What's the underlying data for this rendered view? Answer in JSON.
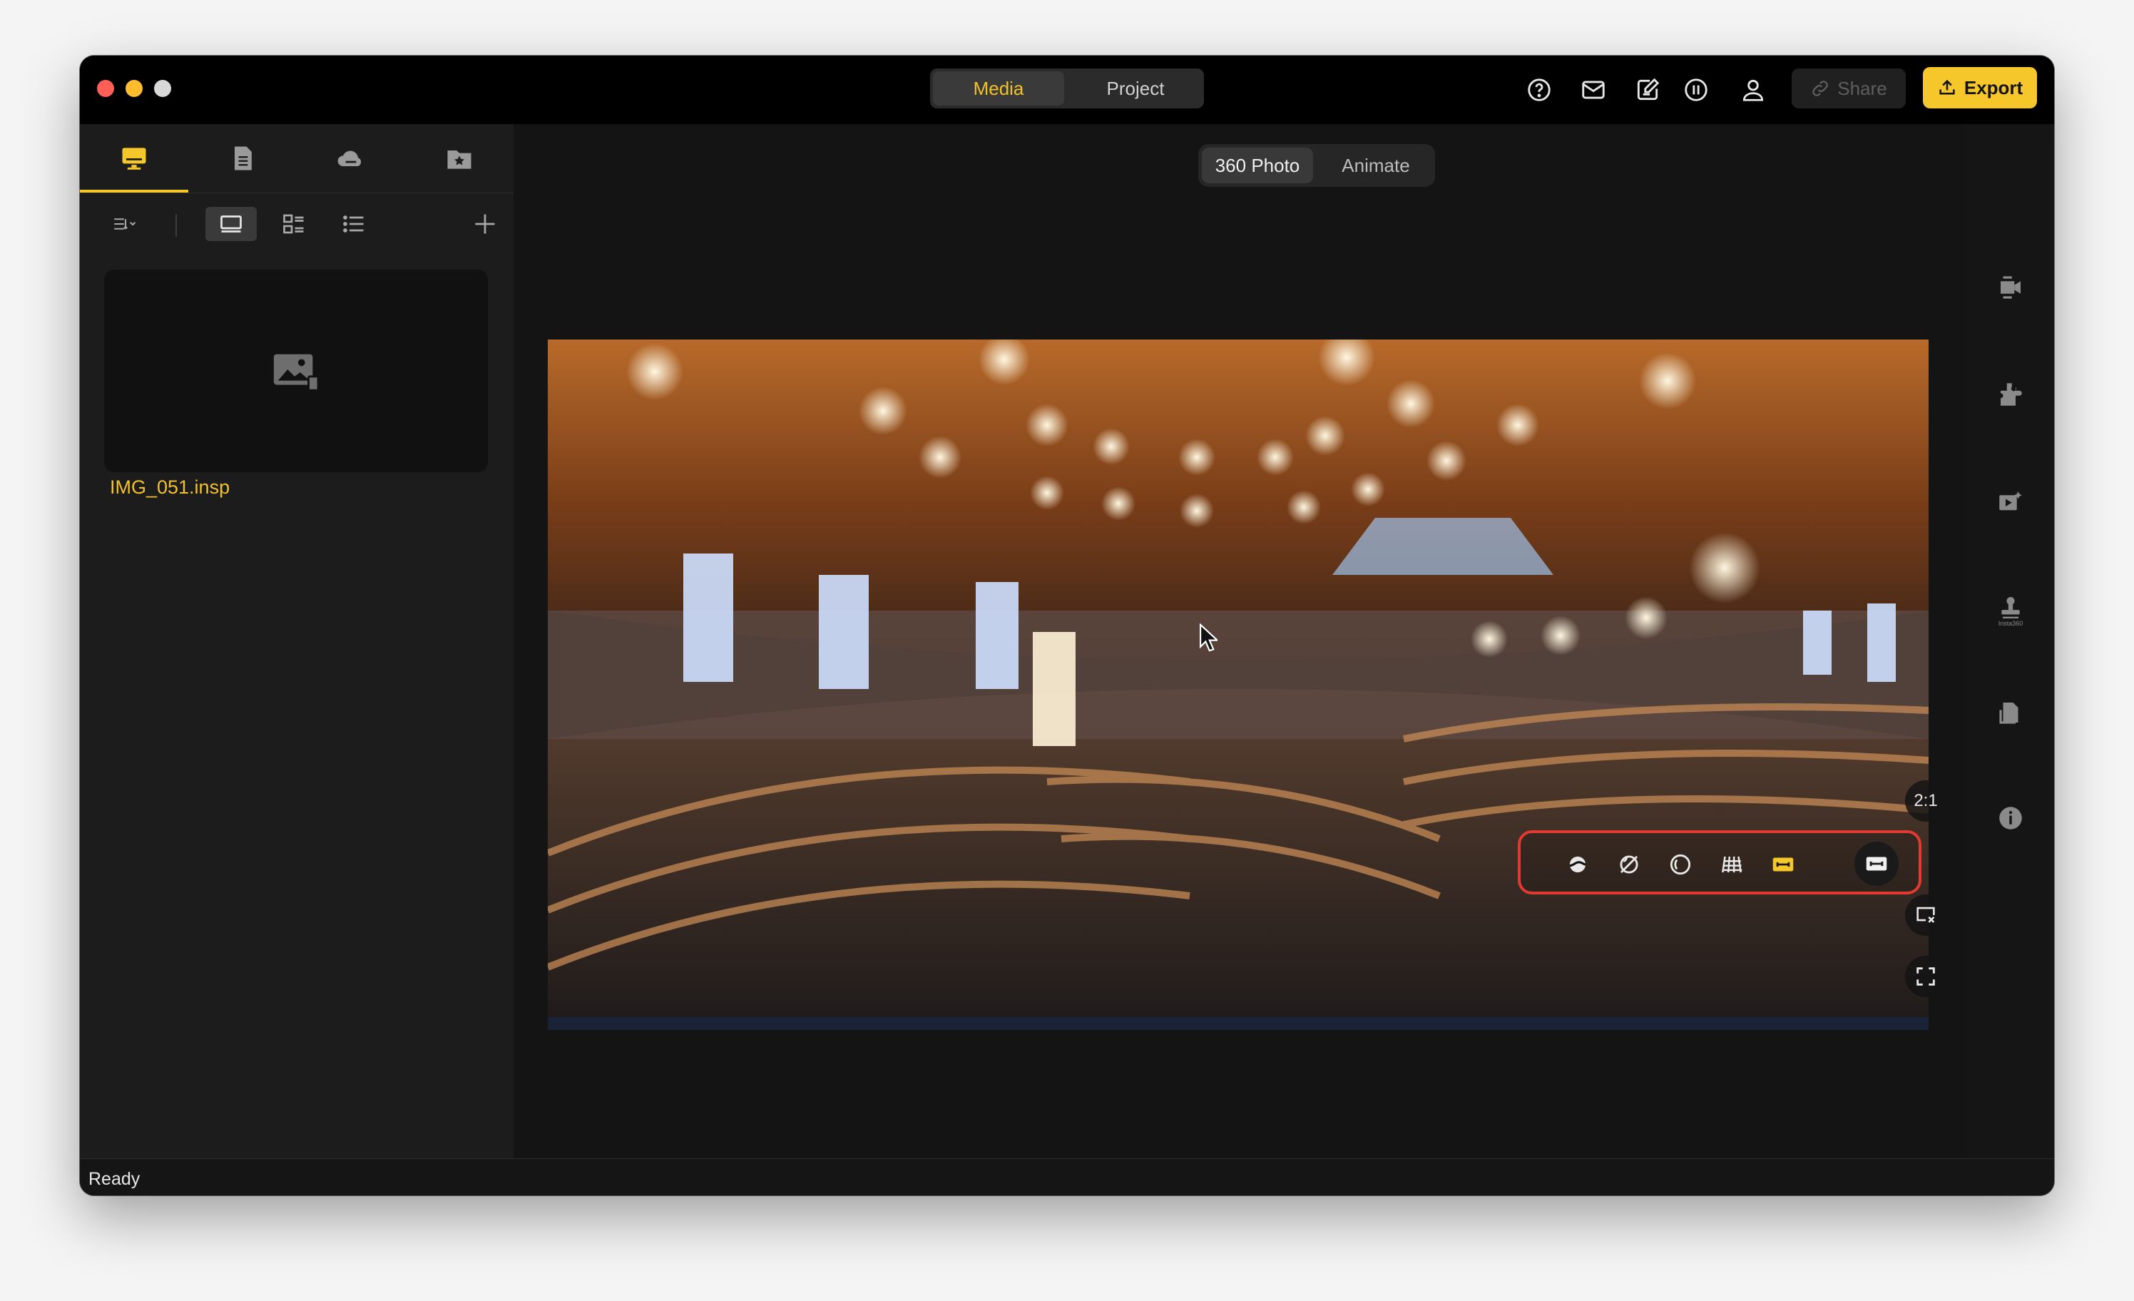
{
  "titlebar": {
    "tabs": [
      {
        "label": "Media",
        "active": true
      },
      {
        "label": "Project",
        "active": false
      }
    ],
    "icons": [
      "help-icon",
      "mail-icon",
      "edit-note-icon",
      "timer-icon",
      "user-icon"
    ],
    "share_label": "Share",
    "export_label": "Export"
  },
  "sidebar": {
    "tabs": [
      "local-media-icon",
      "sd-card-icon",
      "cloud-icon",
      "favorites-icon"
    ],
    "tools": [
      "sort-icon",
      "large-thumbnail-view-icon",
      "grid-view-icon",
      "list-view-icon",
      "add-icon"
    ],
    "files": [
      {
        "name": "IMG_051.insp"
      }
    ]
  },
  "viewer": {
    "modes": [
      {
        "label": "360 Photo",
        "active": true
      },
      {
        "label": "Animate",
        "active": false
      }
    ],
    "aspect_ratio": "2:1",
    "view_modes": [
      "tiny-planet-icon",
      "crystal-ball-icon",
      "fisheye-icon",
      "perspective-grid-icon",
      "flat-view-icon"
    ],
    "active_view_mode": "flat-view-icon"
  },
  "rightbar": {
    "icons": [
      "camera-keyframe-icon",
      "plugin-icon",
      "video-effects-icon",
      "stamp-icon",
      "sd-card-icon",
      "info-icon"
    ],
    "stamp_label": "Insta360"
  },
  "status": {
    "text": "Ready"
  },
  "colors": {
    "accent": "#f6c72a",
    "highlight_border": "#e23a2f",
    "window_bg": "#151515"
  }
}
